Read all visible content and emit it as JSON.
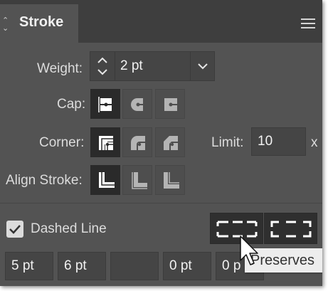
{
  "panel": {
    "title": "Stroke",
    "menu_icon": "hamburger-menu-icon"
  },
  "weight": {
    "label": "Weight:",
    "value": "2 pt"
  },
  "cap": {
    "label": "Cap:",
    "options": [
      "butt-cap-icon",
      "round-cap-icon",
      "projecting-cap-icon"
    ],
    "selected": 0
  },
  "corner": {
    "label": "Corner:",
    "options": [
      "miter-join-icon",
      "round-join-icon",
      "bevel-join-icon"
    ],
    "selected": 0,
    "limit_label": "Limit:",
    "limit_value": "10",
    "limit_unit": "x"
  },
  "align_stroke": {
    "label": "Align Stroke:",
    "options": [
      "align-center-icon",
      "align-inside-icon",
      "align-outside-icon"
    ],
    "selected": 0
  },
  "dashed_line": {
    "label": "Dashed Line",
    "checked": true
  },
  "dash_gap_fields": [
    "5 pt",
    "6 pt",
    "",
    "0 pt",
    "0 p"
  ],
  "tooltip": {
    "text": "Preserves"
  },
  "colors": {
    "panel_bg": "#535353",
    "title_bar": "#3e3e3e",
    "selected_button": "#2a2a2a",
    "text": "#dcdcdc"
  }
}
